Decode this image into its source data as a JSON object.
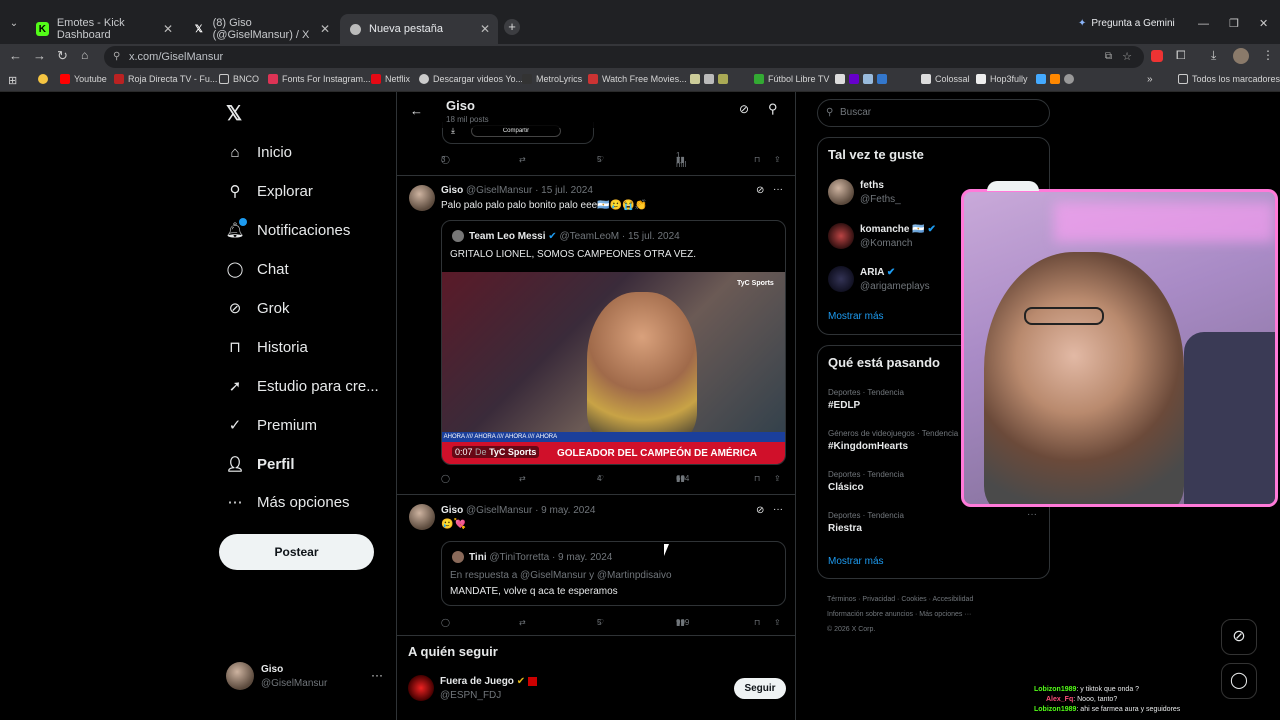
{
  "browser": {
    "tabs": [
      {
        "title": "Emotes - Kick Dashboard",
        "icon": "kick-icon"
      },
      {
        "title": "(8) Giso (@GiselMansur) / X",
        "icon": "x-icon"
      },
      {
        "title": "Nueva pestaña",
        "icon": "chrome-icon"
      }
    ],
    "gemini": "Pregunta a Gemini",
    "url": "x.com/GiselMansur",
    "bookmarks": [
      "Youtube",
      "Roja Directa TV - Fu...",
      "BNCO",
      "Fonts For Instagram...",
      "Netflix",
      "Descargar videos Yo...",
      "MetroLyrics",
      "Watch Free Movies...",
      "Fútbol Libre TV",
      "Colossal",
      "Hop3fully",
      "Todos los marcadores"
    ]
  },
  "nav": {
    "items": [
      "Inicio",
      "Explorar",
      "Notificaciones",
      "Chat",
      "Grok",
      "Historia",
      "Estudio para cre...",
      "Premium",
      "Perfil",
      "Más opciones"
    ],
    "post_button": "Postear",
    "account": {
      "name": "Giso",
      "handle": "@GiselMansur"
    }
  },
  "header": {
    "title": "Giso",
    "subtitle": "18 mil posts"
  },
  "top_post": {
    "share": "Compartir",
    "replies": "3",
    "likes": "5",
    "views": "1 mil"
  },
  "posts": [
    {
      "name": "Giso",
      "handle": "@GiselMansur",
      "date": "· 15 jul. 2024",
      "text": "Palo palo palo palo bonito palo eee🇦🇷🥲😭👏",
      "quote": {
        "name": "Team Leo Messi",
        "handle": "@TeamLeoM",
        "date": "· 15 jul. 2024",
        "text": "GRITALO LIONEL, SOMOS CAMPEONES OTRA VEZ."
      },
      "video": {
        "time": "0:07",
        "brand": "TyC Sports",
        "banner": "GOLEADOR DEL CAMPEÓN DE AMÉRICA",
        "ahora": "AHORA",
        "from": "De"
      },
      "stats": {
        "replies": "",
        "likes": "4",
        "views": "604"
      }
    },
    {
      "name": "Giso",
      "handle": "@GiselMansur",
      "date": "· 9 may. 2024",
      "text": "🥲💘",
      "quote": {
        "name": "Tini",
        "handle": "@TiniTorretta",
        "date": "· 9 may. 2024",
        "reply_to": "En respuesta a @GiselMansur y @Martinpdisaivo",
        "text": "MANDATE, volve q aca te esperamos"
      },
      "stats": {
        "replies": "",
        "likes": "5",
        "views": "999"
      }
    }
  ],
  "who_to_follow": {
    "title": "A quién seguir",
    "account": {
      "name": "Fuera de Juego",
      "handle": "@ESPN_FDJ"
    },
    "follow_label": "Seguir"
  },
  "right": {
    "search_placeholder": "Buscar",
    "suggest_title": "Tal vez te guste",
    "suggestions": [
      {
        "name": "feths",
        "handle": "@Feths_"
      },
      {
        "name": "komanche 🇦🇷",
        "handle": "@Komanch"
      },
      {
        "name": "ARIA",
        "handle": "@arigameplays"
      }
    ],
    "show_more": "Mostrar más",
    "trends_title": "Qué está pasando",
    "trends": [
      {
        "context": "Deportes · Tendencia",
        "title": "#EDLP"
      },
      {
        "context": "Géneros de videojuegos · Tendencia",
        "title": "#KingdomHearts"
      },
      {
        "context": "Deportes · Tendencia",
        "title": "Clásico"
      },
      {
        "context": "Deportes · Tendencia",
        "title": "Riestra"
      }
    ],
    "footer": [
      "Términos",
      "Privacidad",
      "Cookies",
      "Accesibilidad",
      "Información sobre anuncios",
      "Más opciones ···",
      "© 2026 X Corp."
    ]
  },
  "chat_overlay": [
    {
      "user": "Lobizon1989",
      "msg": "y tiktok que onda ?"
    },
    {
      "user": "Alex_Fq",
      "msg": "Nooo, tanto?"
    },
    {
      "user": "Lobizon1989",
      "msg": "ahi se farmea aura y seguidores"
    }
  ],
  "colors": {
    "accent": "#1d9bf0",
    "bg": "#000000",
    "border": "#2f3336",
    "webcam_frame": "#ff7ad9"
  }
}
